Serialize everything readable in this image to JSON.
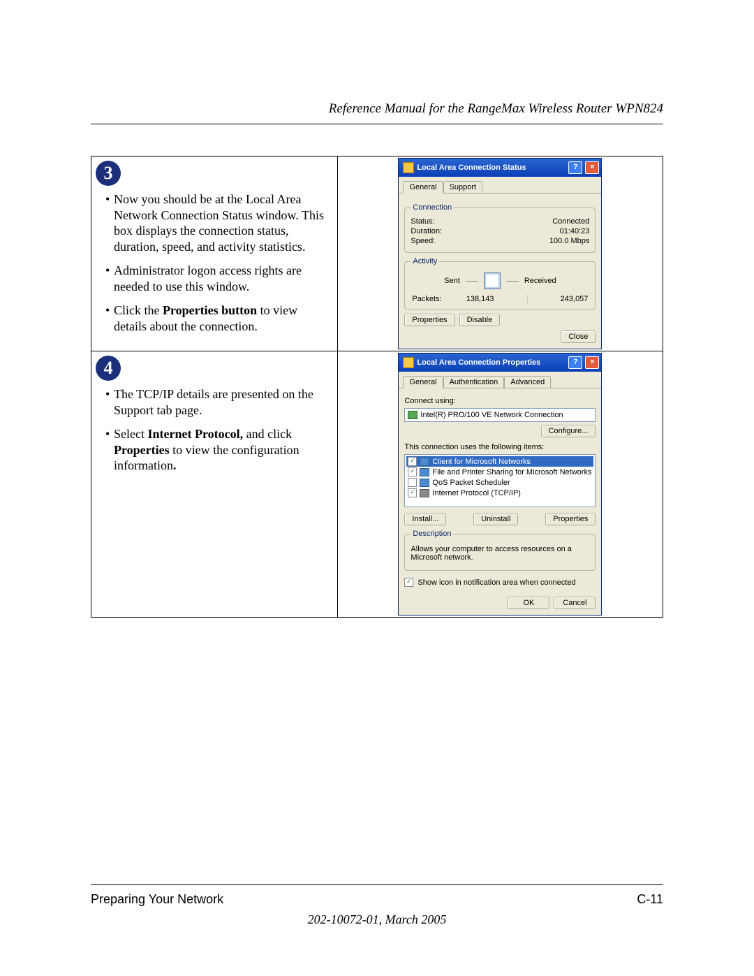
{
  "doc": {
    "header_title": "Reference Manual for the RangeMax Wireless Router WPN824",
    "footer_left": "Preparing Your Network",
    "footer_right": "C-11",
    "footer_sub": "202-10072-01, March 2005"
  },
  "step3": {
    "number": "3",
    "b1": "Now you should be at the Local Area Network Connection Status window. This box displays the connection status, duration, speed, and activity statistics.",
    "b2": "Administrator logon access rights are needed to use this window.",
    "b3_pre": "Click the ",
    "b3_bold": "Properties button",
    "b3_post": " to view details about the connection.",
    "win": {
      "title": "Local Area Connection Status",
      "tabs": {
        "general": "General",
        "support": "Support"
      },
      "group_connection": "Connection",
      "status_lbl": "Status:",
      "status_val": "Connected",
      "duration_lbl": "Duration:",
      "duration_val": "01:40:23",
      "speed_lbl": "Speed:",
      "speed_val": "100.0 Mbps",
      "group_activity": "Activity",
      "sent": "Sent",
      "received": "Received",
      "packets_lbl": "Packets:",
      "packets_sent": "138,143",
      "packets_recv": "243,057",
      "btn_properties": "Properties",
      "btn_disable": "Disable",
      "btn_close": "Close"
    }
  },
  "step4": {
    "number": "4",
    "b1": "The TCP/IP details are presented on the Support tab page.",
    "b2_pre": "Select ",
    "b2_bold1": "Internet Protocol,",
    "b2_mid": " and click ",
    "b2_bold2": "Properties",
    "b2_post": " to view the configuration information",
    "b2_dot": ".",
    "win": {
      "title": "Local Area Connection Properties",
      "tabs": {
        "general": "General",
        "auth": "Authentication",
        "advanced": "Advanced"
      },
      "connect_using": "Connect using:",
      "adapter": "Intel(R) PRO/100 VE Network Connection",
      "btn_configure": "Configure...",
      "items_label": "This connection uses the following items:",
      "items": {
        "client": "Client for Microsoft Networks",
        "fps": "File and Printer Sharing for Microsoft Networks",
        "qos": "QoS Packet Scheduler",
        "tcpip": "Internet Protocol (TCP/IP)"
      },
      "btn_install": "Install...",
      "btn_uninstall": "Uninstall",
      "btn_properties": "Properties",
      "group_desc": "Description",
      "desc_text": "Allows your computer to access resources on a Microsoft network.",
      "show_icon": "Show icon in notification area when connected",
      "btn_ok": "OK",
      "btn_cancel": "Cancel"
    }
  }
}
